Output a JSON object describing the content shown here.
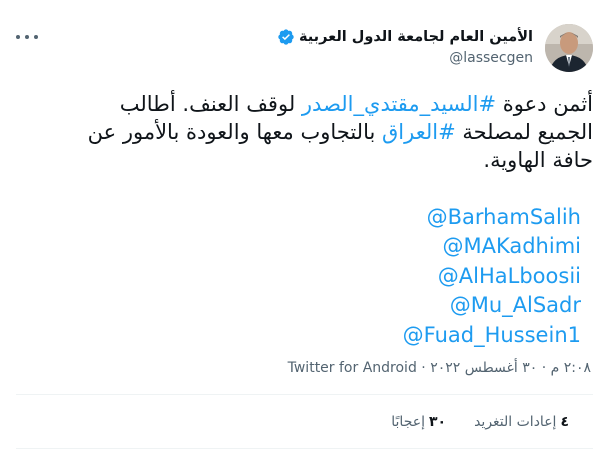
{
  "author": {
    "display_name": "الأمين العام لجامعة الدول العربية",
    "handle": "@lassecgen"
  },
  "tweet": {
    "part1": "أثمن دعوة ",
    "hashtag1": "#السيد_مقتدي_الصدر",
    "part2": " لوقف العنف. أطالب الجميع لمصلحة ",
    "hashtag2": "#العراق",
    "part3": " بالتجاوب معها والعودة بالأمور عن حافة الهاوية."
  },
  "mentions": [
    "@BarhamSalih",
    "@MAKadhimi",
    "@AlHaLboosii",
    "@Mu_AlSadr",
    "@Fuad_Hussein1"
  ],
  "meta": {
    "time_date": "٢:٠٨ م · ٣٠ أغسطس ٢٠٢٢ · ",
    "source": "Twitter for Android"
  },
  "stats": {
    "retweets_count": "٤",
    "retweets_label": "إعادات التغريد",
    "likes_count": "٣٠",
    "likes_label": "إعجابًا"
  },
  "colors": {
    "link": "#1d9bf0",
    "text": "#0f1419",
    "muted": "#536471"
  },
  "icons": {
    "more": "more-dots-icon",
    "verified": "verified-badge-icon"
  }
}
